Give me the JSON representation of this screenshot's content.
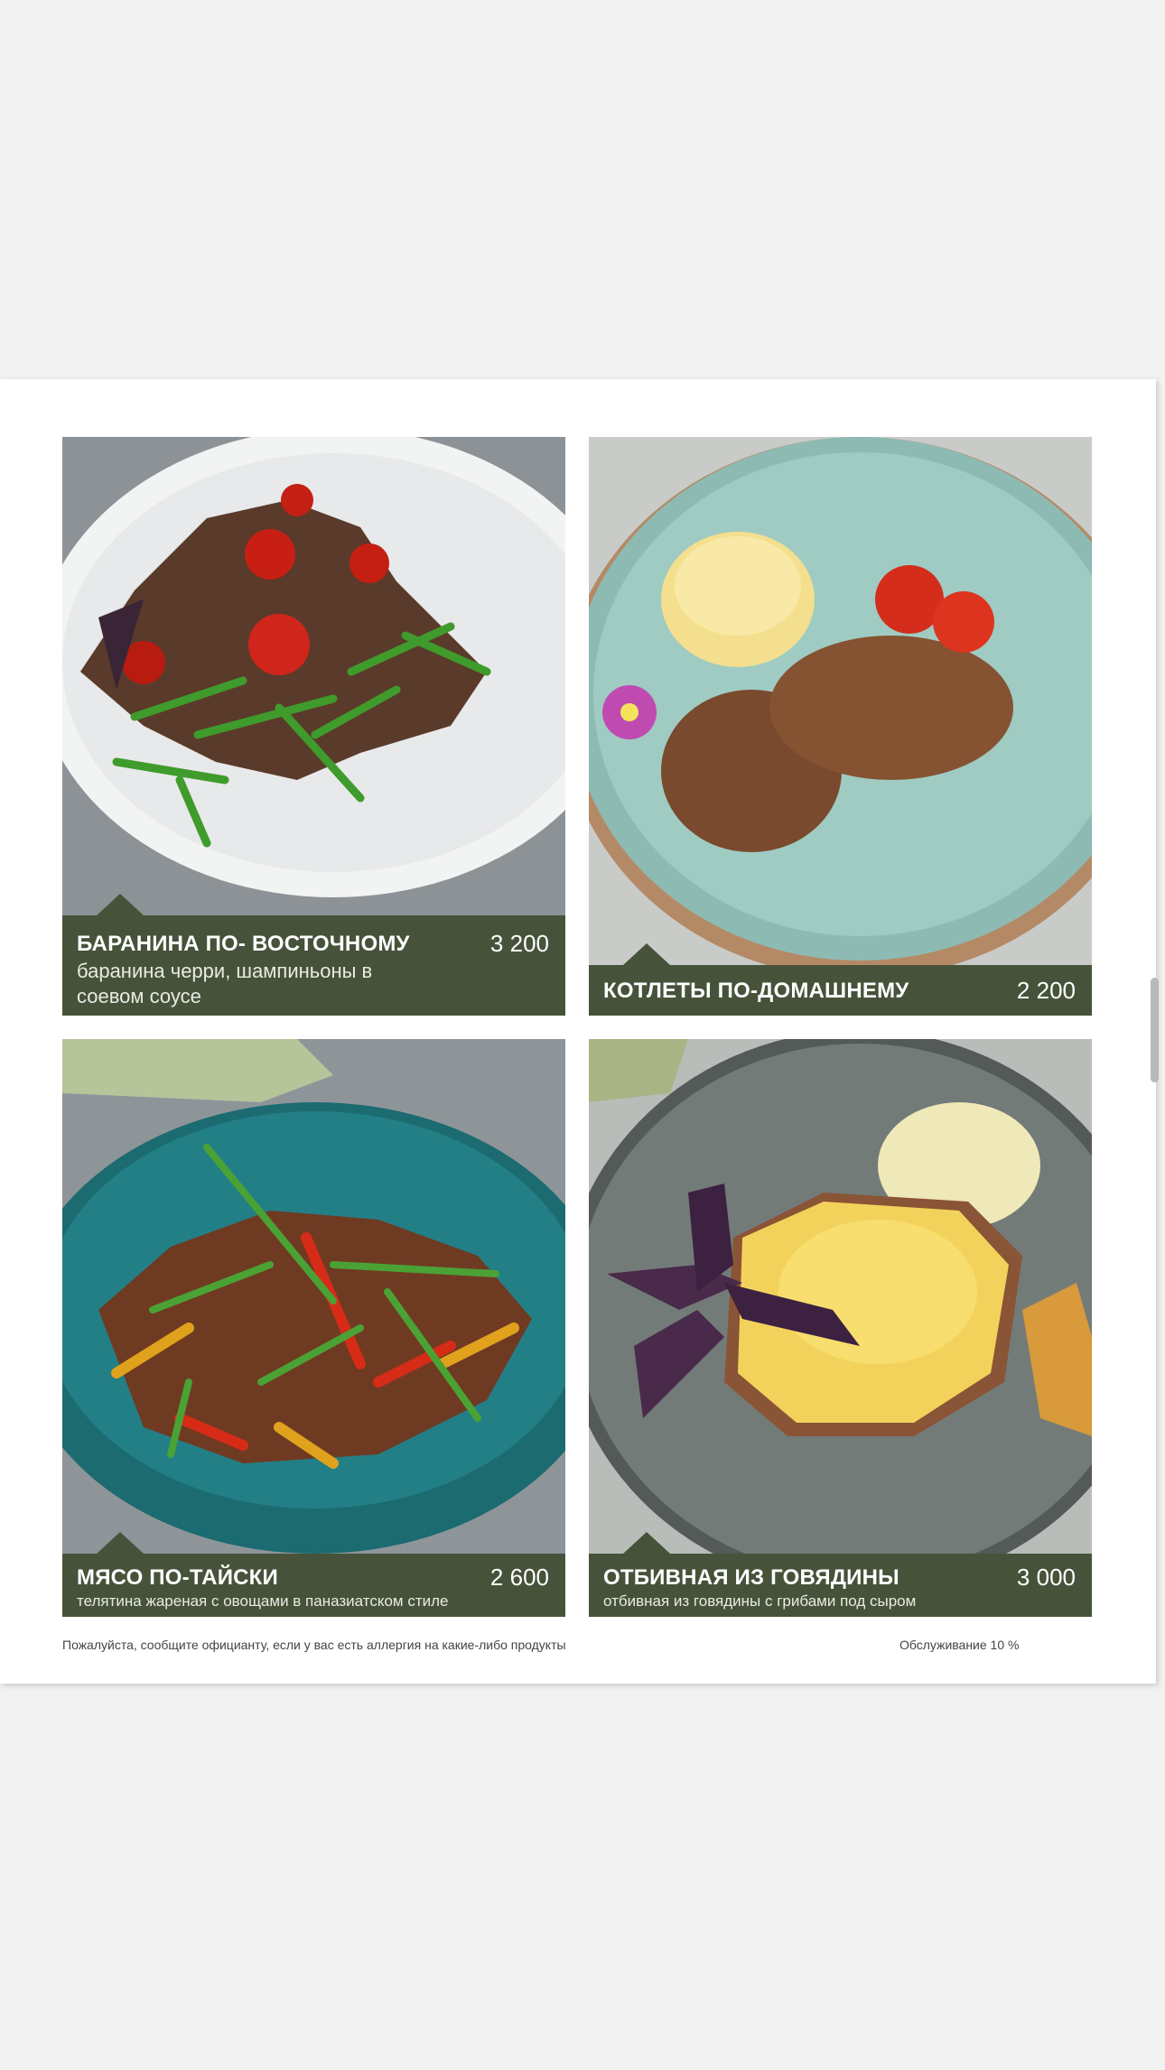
{
  "menu": {
    "items": [
      {
        "title": "БАРАНИНА ПО- ВОСТОЧНОМУ",
        "price": "3 200",
        "description": "баранина  черри, шампиньоны в соевом соусе"
      },
      {
        "title": "КОТЛЕТЫ ПО-ДОМАШНЕМУ",
        "price": "2 200",
        "description": ""
      },
      {
        "title": "МЯСО ПО-ТАЙСКИ",
        "price": "2 600",
        "description": "телятина  жареная с овощами в паназиатском стиле"
      },
      {
        "title": "ОТБИВНАЯ ИЗ ГОВЯДИНЫ",
        "price": "3 000",
        "description": "отбивная из говядины с грибами под сыром"
      }
    ]
  },
  "footer": {
    "allergy_note": "Пожалуйста, сообщите официанту, если у вас есть аллергия на какие-либо продукты",
    "service": "Обслуживание 10 %"
  },
  "colors": {
    "label_bg": "#46533a",
    "page_bg": "#f2f2f2"
  }
}
